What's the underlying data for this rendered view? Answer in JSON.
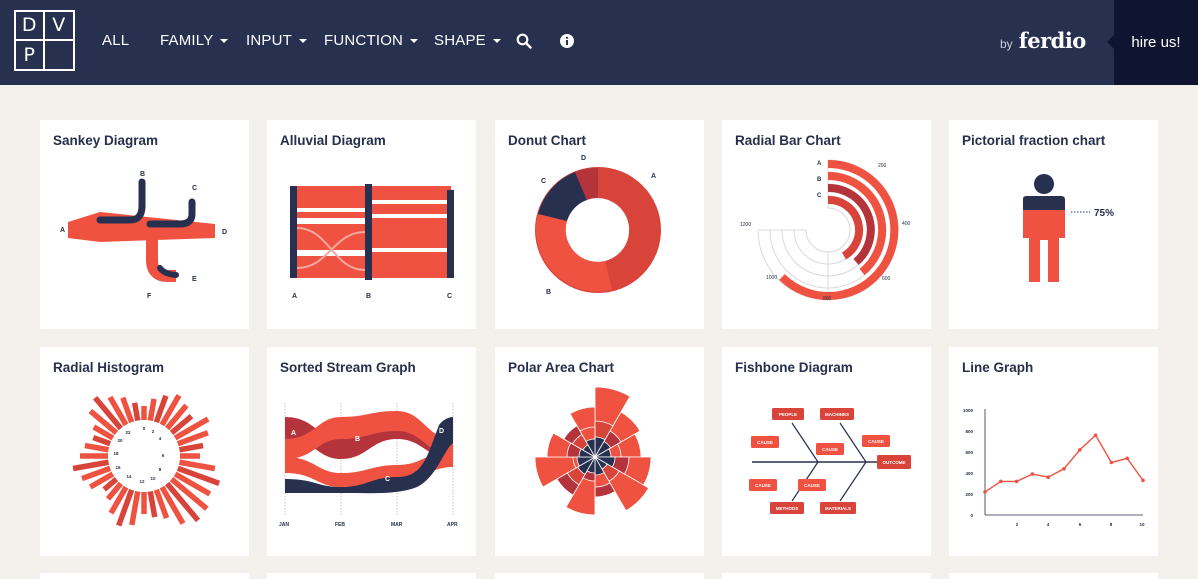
{
  "logo": {
    "letters": [
      "D",
      "V",
      "P",
      ""
    ]
  },
  "nav": {
    "items": [
      {
        "label": "ALL",
        "dropdown": false
      },
      {
        "label": "FAMILY",
        "dropdown": true
      },
      {
        "label": "INPUT",
        "dropdown": true
      },
      {
        "label": "FUNCTION",
        "dropdown": true
      },
      {
        "label": "SHAPE",
        "dropdown": true
      }
    ],
    "icons": [
      "search-icon",
      "info-icon"
    ],
    "by": "by",
    "brand": "ferdio",
    "hire": "hire us!"
  },
  "colors": {
    "navy": "#27304f",
    "red": "#ef5240",
    "dark_red": "#b5343b",
    "background": "#f4f0eb"
  },
  "cards": [
    {
      "title": "Sankey Diagram",
      "labels": [
        "A",
        "B",
        "C",
        "D",
        "E",
        "F"
      ]
    },
    {
      "title": "Alluvial Diagram",
      "labels": [
        "A",
        "B",
        "C"
      ]
    },
    {
      "title": "Donut Chart",
      "labels": [
        "A",
        "B",
        "C",
        "D"
      ]
    },
    {
      "title": "Radial Bar Chart",
      "labels": [
        "A",
        "B",
        "C",
        "200",
        "400",
        "600",
        "800",
        "1000",
        "1200"
      ]
    },
    {
      "title": "Pictorial fraction chart",
      "value": "75%"
    },
    {
      "title": "Radial Histogram",
      "labels": [
        "0",
        "2",
        "4",
        "6",
        "8",
        "10",
        "12",
        "14",
        "16",
        "18",
        "20",
        "22"
      ]
    },
    {
      "title": "Sorted Stream Graph",
      "labels": [
        "A",
        "B",
        "C",
        "D",
        "JAN",
        "FEB",
        "MAR",
        "APR"
      ]
    },
    {
      "title": "Polar Area Chart"
    },
    {
      "title": "Fishbone Diagram",
      "labels": [
        "PEOPLE",
        "MACHINES",
        "CAUSE",
        "CAUSE",
        "CAUSE",
        "OUTCOME",
        "CAUSE",
        "CAUSE",
        "METHODS",
        "MATERIALS"
      ]
    },
    {
      "title": "Line Graph",
      "y_ticks": [
        "1000",
        "800",
        "600",
        "400",
        "200",
        "0"
      ],
      "x_ticks": [
        "2",
        "4",
        "6",
        "8",
        "10"
      ],
      "chart_data": {
        "type": "line",
        "x": [
          0,
          1,
          2,
          3,
          4,
          5,
          6,
          7,
          8,
          9,
          10
        ],
        "y": [
          220,
          320,
          320,
          390,
          360,
          440,
          620,
          760,
          500,
          540,
          330
        ],
        "ylim": [
          0,
          1000
        ],
        "xlim": [
          0,
          10
        ]
      }
    }
  ]
}
